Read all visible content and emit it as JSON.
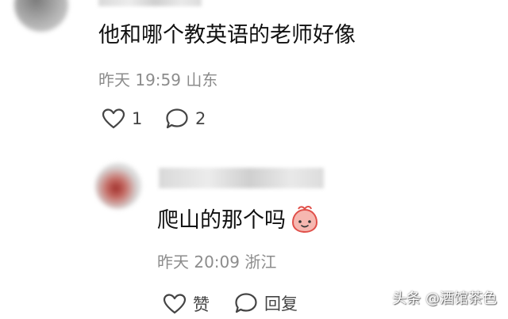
{
  "comment1": {
    "text": "他和哪个教英语的老师好像",
    "time": "昨天 19:59",
    "location": "山东",
    "like_count": "1",
    "reply_count": "2"
  },
  "reply1": {
    "text": "爬山的那个吗",
    "time": "昨天 20:09",
    "location": "浙江",
    "like_label": "赞",
    "reply_label": "回复"
  },
  "icons": {
    "like": "heart-outline-icon",
    "comment": "speech-bubble-icon",
    "emoji": "peach-face-emoji"
  },
  "watermark": "头条 @酒馆茶色",
  "colors": {
    "meta_text": "#8c8c8c",
    "icon_stroke": "#444444",
    "emoji_fill": "#f6b7b0",
    "emoji_outline": "#e0504a"
  }
}
